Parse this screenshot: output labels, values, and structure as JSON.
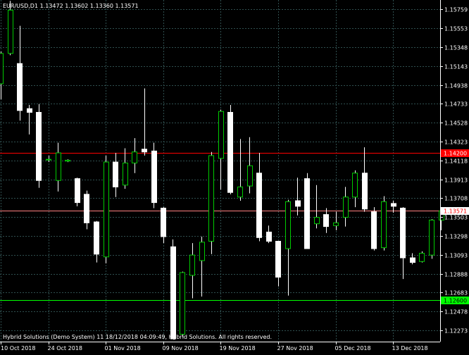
{
  "title": "EUR/USD,D1  1.13472  1.13602  1.13360  1.13571",
  "footer": "Hybrid Solutions (Demo System) 11 18/12/2018 04:09:49, Hybrid Solutions. All rights reserved.",
  "colors": {
    "background": "#000000",
    "grid": "#2f4f4f",
    "up_candle": "#00cc00",
    "down_candle": "#ffffff",
    "wick": "#ffffff",
    "axis_text": "#ffffff",
    "line_red": "#ff0000",
    "line_pink": "#ff8080",
    "line_green": "#00ff00"
  },
  "chart_data": {
    "type": "candlestick",
    "symbol": "EUR/USD",
    "timeframe": "D1",
    "ohlc_header": {
      "open": 1.13472,
      "high": 1.13602,
      "low": 1.1336,
      "close": 1.13571
    },
    "y_ticks": [
      1.15759,
      1.15553,
      1.15348,
      1.15143,
      1.14938,
      1.14733,
      1.14528,
      1.14323,
      1.14118,
      1.13913,
      1.13708,
      1.13503,
      1.13298,
      1.13093,
      1.12888,
      1.12683,
      1.12478,
      1.12273
    ],
    "x_ticks": [
      "10 Oct 2018",
      "24 Oct 2018",
      "01 Nov 2018",
      "09 Nov 2018",
      "19 Nov 2018",
      "27 Nov 2018",
      "05 Dec 2018",
      "13 Dec 2018"
    ],
    "x_tick_bar_index": [
      0,
      5,
      11,
      17,
      23,
      29,
      35,
      41
    ],
    "ylim": [
      1.1215,
      1.1586
    ],
    "horizontal_lines": [
      {
        "price": 1.142,
        "label": "1.14200",
        "color": "#ff0000",
        "tag_bg": "#ff0000",
        "tag_text": "#ffffff"
      },
      {
        "price": 1.13571,
        "label": "1.13571",
        "color": "#ff8080",
        "tag_bg": "#ffffff",
        "tag_text": "#ff0000"
      },
      {
        "price": 1.126,
        "label": "1.12600",
        "color": "#00ff00",
        "tag_bg": "#00ff00",
        "tag_text": "#000000"
      }
    ],
    "candles": [
      {
        "o": 1.1495,
        "h": 1.153,
        "l": 1.1478,
        "c": 1.1528
      },
      {
        "o": 1.1528,
        "h": 1.1585,
        "l": 1.1526,
        "c": 1.1575
      },
      {
        "o": 1.1517,
        "h": 1.1558,
        "l": 1.1455,
        "c": 1.1466
      },
      {
        "o": 1.1468,
        "h": 1.1472,
        "l": 1.144,
        "c": 1.1464
      },
      {
        "o": 1.1464,
        "h": 1.1473,
        "l": 1.1382,
        "c": 1.139
      },
      {
        "o": 1.1413,
        "h": 1.1417,
        "l": 1.141,
        "c": 1.1413
      },
      {
        "o": 1.139,
        "h": 1.1431,
        "l": 1.1378,
        "c": 1.142
      },
      {
        "o": 1.1411,
        "h": 1.1413,
        "l": 1.141,
        "c": 1.1412
      },
      {
        "o": 1.1392,
        "h": 1.1393,
        "l": 1.1362,
        "c": 1.1366
      },
      {
        "o": 1.1375,
        "h": 1.1379,
        "l": 1.1337,
        "c": 1.1344
      },
      {
        "o": 1.1345,
        "h": 1.1346,
        "l": 1.1301,
        "c": 1.131
      },
      {
        "o": 1.1307,
        "h": 1.1417,
        "l": 1.13,
        "c": 1.141
      },
      {
        "o": 1.141,
        "h": 1.142,
        "l": 1.1372,
        "c": 1.1383
      },
      {
        "o": 1.1385,
        "h": 1.1425,
        "l": 1.1381,
        "c": 1.1409
      },
      {
        "o": 1.1409,
        "h": 1.1436,
        "l": 1.1398,
        "c": 1.1421
      },
      {
        "o": 1.1424,
        "h": 1.149,
        "l": 1.1417,
        "c": 1.1421
      },
      {
        "o": 1.1422,
        "h": 1.1431,
        "l": 1.136,
        "c": 1.1366
      },
      {
        "o": 1.136,
        "h": 1.1361,
        "l": 1.1322,
        "c": 1.1329
      },
      {
        "o": 1.1318,
        "h": 1.1326,
        "l": 1.1218,
        "c": 1.1218
      },
      {
        "o": 1.1223,
        "h": 1.1291,
        "l": 1.122,
        "c": 1.129
      },
      {
        "o": 1.1287,
        "h": 1.1322,
        "l": 1.1262,
        "c": 1.1309
      },
      {
        "o": 1.1303,
        "h": 1.1329,
        "l": 1.1264,
        "c": 1.1323
      },
      {
        "o": 1.1324,
        "h": 1.1421,
        "l": 1.131,
        "c": 1.1417
      },
      {
        "o": 1.1414,
        "h": 1.1467,
        "l": 1.138,
        "c": 1.1465
      },
      {
        "o": 1.1464,
        "h": 1.1472,
        "l": 1.1375,
        "c": 1.1377
      },
      {
        "o": 1.1372,
        "h": 1.1435,
        "l": 1.1368,
        "c": 1.1383
      },
      {
        "o": 1.1384,
        "h": 1.1437,
        "l": 1.1376,
        "c": 1.1406
      },
      {
        "o": 1.1398,
        "h": 1.142,
        "l": 1.1324,
        "c": 1.1328
      },
      {
        "o": 1.1334,
        "h": 1.1341,
        "l": 1.1322,
        "c": 1.1324
      },
      {
        "o": 1.1324,
        "h": 1.1324,
        "l": 1.1275,
        "c": 1.1285
      },
      {
        "o": 1.1316,
        "h": 1.1369,
        "l": 1.1265,
        "c": 1.1367
      },
      {
        "o": 1.1368,
        "h": 1.1393,
        "l": 1.1352,
        "c": 1.1362
      },
      {
        "o": 1.1392,
        "h": 1.1398,
        "l": 1.1316,
        "c": 1.1316
      },
      {
        "o": 1.1343,
        "h": 1.1385,
        "l": 1.1338,
        "c": 1.135
      },
      {
        "o": 1.1353,
        "h": 1.136,
        "l": 1.1333,
        "c": 1.134
      },
      {
        "o": 1.1341,
        "h": 1.1356,
        "l": 1.1336,
        "c": 1.1344
      },
      {
        "o": 1.135,
        "h": 1.1383,
        "l": 1.134,
        "c": 1.1372
      },
      {
        "o": 1.1372,
        "h": 1.1401,
        "l": 1.1361,
        "c": 1.1398
      },
      {
        "o": 1.1398,
        "h": 1.1426,
        "l": 1.1356,
        "c": 1.1359
      },
      {
        "o": 1.1356,
        "h": 1.1361,
        "l": 1.1314,
        "c": 1.1316
      },
      {
        "o": 1.1317,
        "h": 1.1373,
        "l": 1.1314,
        "c": 1.1367
      },
      {
        "o": 1.1365,
        "h": 1.1368,
        "l": 1.1355,
        "c": 1.1362
      },
      {
        "o": 1.136,
        "h": 1.1361,
        "l": 1.1283,
        "c": 1.1306
      },
      {
        "o": 1.1306,
        "h": 1.1311,
        "l": 1.1299,
        "c": 1.1301
      },
      {
        "o": 1.1302,
        "h": 1.1313,
        "l": 1.1301,
        "c": 1.1311
      },
      {
        "o": 1.1309,
        "h": 1.1348,
        "l": 1.1305,
        "c": 1.1347
      },
      {
        "o": 1.1347,
        "h": 1.136,
        "l": 1.1336,
        "c": 1.1357
      }
    ]
  }
}
